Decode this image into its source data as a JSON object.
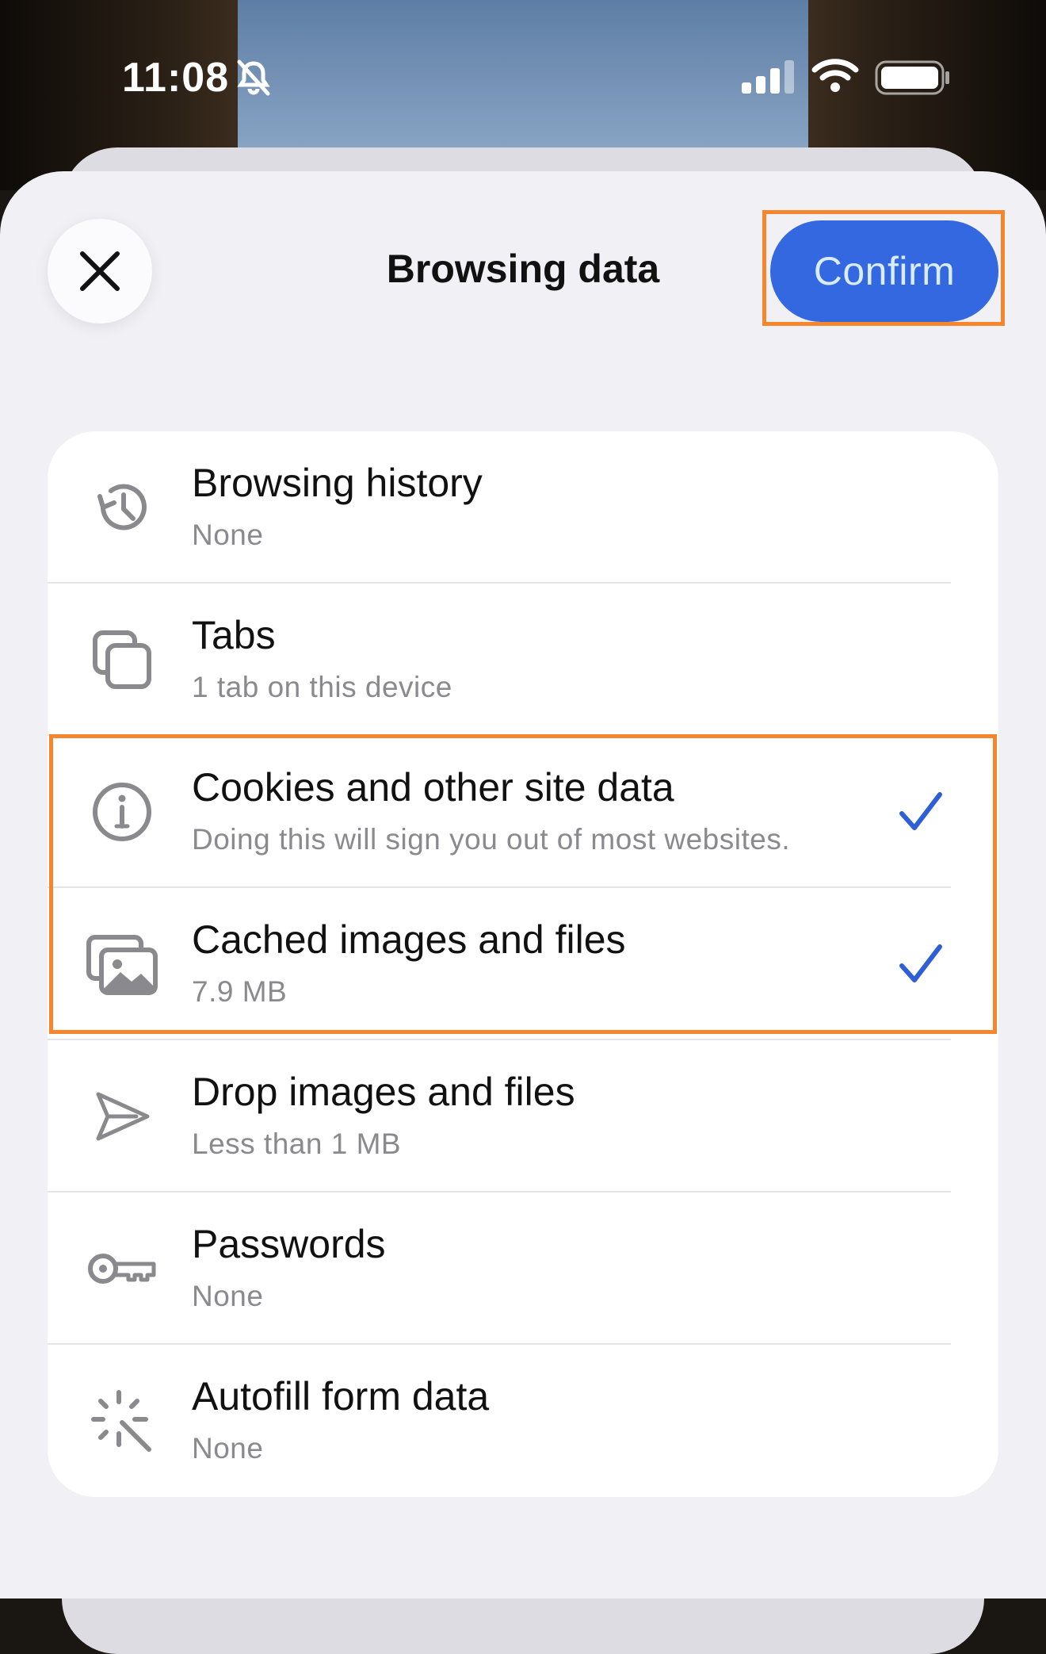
{
  "status_bar": {
    "time": "11:08"
  },
  "header": {
    "title": "Browsing data",
    "confirm_label": "Confirm"
  },
  "rows": [
    {
      "title": "Browsing history",
      "subtitle": "None",
      "icon": "history-icon",
      "checked": false
    },
    {
      "title": "Tabs",
      "subtitle": "1 tab on this device",
      "icon": "tabs-icon",
      "checked": false
    },
    {
      "title": "Cookies and other site data",
      "subtitle": "Doing this will sign you out of most websites.",
      "icon": "info-icon",
      "checked": true
    },
    {
      "title": "Cached images and files",
      "subtitle": "7.9 MB",
      "icon": "images-icon",
      "checked": true
    },
    {
      "title": "Drop images and files",
      "subtitle": "Less than 1 MB",
      "icon": "send-icon",
      "checked": false
    },
    {
      "title": "Passwords",
      "subtitle": "None",
      "icon": "key-icon",
      "checked": false
    },
    {
      "title": "Autofill form data",
      "subtitle": "None",
      "icon": "magic-wand-icon",
      "checked": false
    }
  ],
  "colors": {
    "accent": "#3468e0",
    "highlight": "#f5862d",
    "check": "#2f5fd6"
  }
}
